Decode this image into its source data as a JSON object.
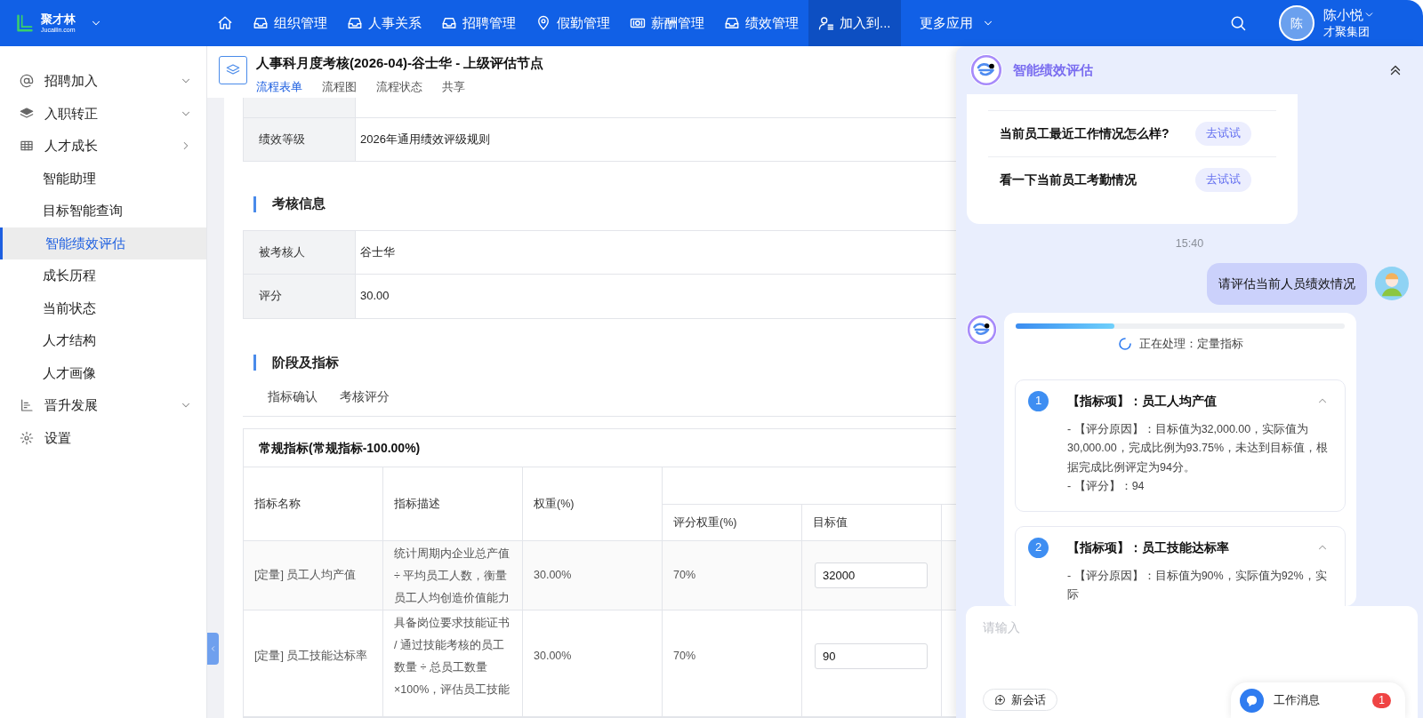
{
  "brand": {
    "name": "聚才林",
    "domain": "Jucailin.com"
  },
  "top_nav": [
    {
      "kind": "home",
      "selected": false
    },
    {
      "kind": "module",
      "label": "组织管理",
      "selected": false
    },
    {
      "kind": "module",
      "label": "人事关系",
      "selected": false
    },
    {
      "kind": "module",
      "label": "招聘管理",
      "selected": false
    },
    {
      "kind": "location",
      "label": "假勤管理",
      "selected": false
    },
    {
      "kind": "payroll",
      "label": "薪酬管理",
      "selected": false
    },
    {
      "kind": "module",
      "label": "绩效管理",
      "selected": false
    },
    {
      "kind": "member",
      "label": "加入到...",
      "selected": true
    },
    {
      "kind": "more",
      "label": "更多应用",
      "selected": false
    }
  ],
  "user": {
    "avatar": "陈",
    "name": "陈小悦",
    "company": "才聚集团"
  },
  "sidebar": {
    "items": [
      {
        "kind": "at",
        "label": "招聘加入",
        "expanded": false
      },
      {
        "kind": "layers",
        "label": "入职转正",
        "expanded": false
      },
      {
        "kind": "table",
        "label": "人才成长",
        "expanded": true,
        "children": [
          {
            "label": "智能助理",
            "selected": false
          },
          {
            "label": "目标智能查询",
            "selected": false
          },
          {
            "label": "智能绩效评估",
            "selected": true
          },
          {
            "label": "成长历程",
            "selected": false
          },
          {
            "label": "当前状态",
            "selected": false
          },
          {
            "label": "人才结构",
            "selected": false
          },
          {
            "label": "人才画像",
            "selected": false
          }
        ]
      },
      {
        "kind": "chart",
        "label": "晋升发展",
        "expanded": false
      },
      {
        "kind": "gear",
        "label": "设置"
      }
    ]
  },
  "page": {
    "title": "人事科月度考核(2026-04)-谷士华 - 上级评估节点",
    "tabs": [
      {
        "label": "流程表单",
        "selected": true
      },
      {
        "label": "流程图",
        "selected": false
      },
      {
        "label": "流程状态",
        "selected": false
      },
      {
        "label": "共享",
        "selected": false
      }
    ],
    "top_rows": [
      {
        "label": "绩效等级",
        "value": "2026年通用绩效评级规则"
      }
    ],
    "sections": [
      {
        "title": "考核信息",
        "rows": [
          {
            "label": "被考核人",
            "value": "谷士华"
          },
          {
            "label": "评分",
            "value": "30.00"
          }
        ]
      }
    ],
    "stage_section": {
      "title": "阶段及指标",
      "tabs": [
        {
          "label": "指标确认",
          "selected": false
        },
        {
          "label": "考核评分",
          "selected": false
        }
      ]
    },
    "indicator_table": {
      "title": "常规指标(常规指标-100.00%)",
      "columns": [
        "指标名称",
        "指标描述",
        "权重(%)"
      ],
      "sub_columns": [
        "评分权重(%)",
        "目标值"
      ],
      "rows": [
        {
          "name": "[定量] 员工人均产值",
          "description": "统计周期内企业总产值 ÷ 平均员工人数，衡量员工人均创造价值能力",
          "weight": "30.00%",
          "score_weight": "70%",
          "target": "32000"
        },
        {
          "name": "[定量] 员工技能达标率",
          "description": "具备岗位要求技能证书 / 通过技能考核的员工数量 ÷ 总员工数量 ×100%，评估员工技能",
          "weight": "30.00%",
          "score_weight": "70%",
          "target": "90"
        }
      ]
    }
  },
  "assistant": {
    "title": "智能绩效评估",
    "suggestions": [
      {
        "question": "当前员工最近工作情况怎么样?",
        "action": "去试试"
      },
      {
        "question": "看一下当前员工考勤情况",
        "action": "去试试"
      }
    ],
    "time": "15:40",
    "user_message": "请评估当前人员绩效情况",
    "progress": {
      "level": 0.3,
      "status": "正在处理：定量指标"
    },
    "items": [
      {
        "number": "1",
        "title": "【指标项】：员工人均产值",
        "expanded": true,
        "lines": [
          "- 【评分原因】：目标值为32,000.00，实际值为30,000.00，完成比例为93.75%，未达到目标值，根据完成比例评定为94分。",
          "- 【评分】：94"
        ]
      },
      {
        "number": "2",
        "title": "【指标项】：员工技能达标率",
        "expanded": true,
        "lines": [
          "- 【评分原因】：目标值为90%，实际值为92%，实际"
        ]
      }
    ],
    "input": {
      "placeholder": "请输入"
    },
    "new_chat": "新会话",
    "work_messages": {
      "label": "工作消息",
      "count": "1"
    }
  }
}
